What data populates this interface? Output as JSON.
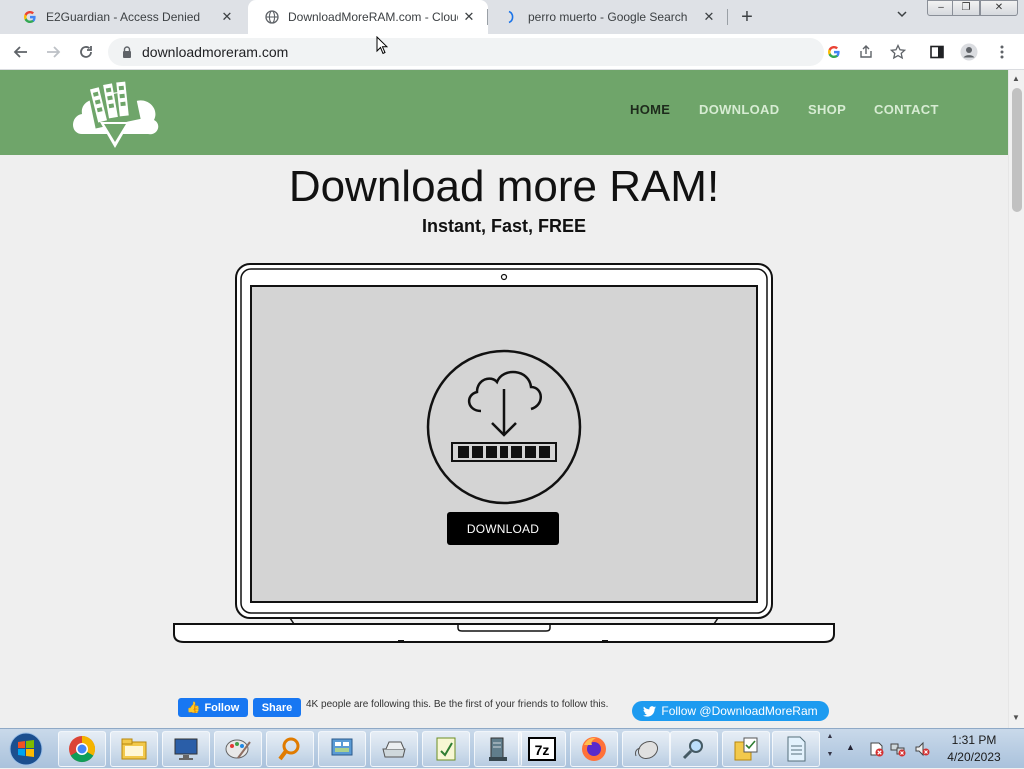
{
  "browser": {
    "tabs": [
      {
        "title": "E2Guardian - Access Denied",
        "favicon": "google-g-icon",
        "active": false
      },
      {
        "title": "DownloadMoreRAM.com - Cloud",
        "favicon": "globe-icon",
        "active": true
      },
      {
        "title": "perro muerto - Google Search",
        "favicon": "loading-icon",
        "active": false
      }
    ],
    "url": "downloadmoreram.com"
  },
  "site": {
    "nav": [
      {
        "label": "HOME",
        "active": true
      },
      {
        "label": "DOWNLOAD",
        "active": false
      },
      {
        "label": "SHOP",
        "active": false
      },
      {
        "label": "CONTACT",
        "active": false
      }
    ],
    "title": "Download more RAM!",
    "subtitle": "Instant, Fast, FREE",
    "download_label": "DOWNLOAD",
    "fb_follow": "Follow",
    "fb_share": "Share",
    "fb_text": "4K people are following this. Be the first of your friends to follow this.",
    "twitter_follow": "Follow @DownloadMoreRam"
  },
  "colors": {
    "header_green": "#6fa56a",
    "facebook_blue": "#1877f2",
    "twitter_blue": "#1d9bf0"
  },
  "taskbar": {
    "apps": [
      "chrome-icon",
      "file-explorer-icon",
      "remote-desktop-icon",
      "paint-icon",
      "search-magnifier-icon",
      "control-panel-icon",
      "scanner-icon",
      "notepad-icon",
      "server-icon",
      "7zip-icon",
      "firefox-icon",
      "mouse-icon",
      "network-search-icon",
      "folder-tasks-icon",
      "document-icon"
    ],
    "time": "1:31 PM",
    "date": "4/20/2023"
  }
}
